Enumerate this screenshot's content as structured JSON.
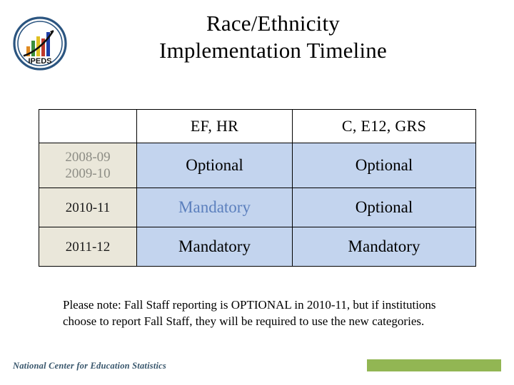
{
  "slide": {
    "title_line1": "Race/Ethnicity",
    "title_line2": "Implementation Timeline",
    "logo_label": "IPEDS",
    "logo_name": "ipeds-logo"
  },
  "table": {
    "columns": [
      "",
      "EF, HR",
      "C, E12, GRS"
    ],
    "rows": [
      {
        "period_line1": "2008-09",
        "period_line2": "2009-10",
        "muted": true,
        "values": [
          "Optional",
          "Optional"
        ],
        "accent": [
          false,
          false
        ]
      },
      {
        "period_line1": "2010-11",
        "period_line2": "",
        "muted": false,
        "values": [
          "Mandatory",
          "Optional"
        ],
        "accent": [
          true,
          false
        ]
      },
      {
        "period_line1": "2011-12",
        "period_line2": "",
        "muted": false,
        "values": [
          "Mandatory",
          "Mandatory"
        ],
        "accent": [
          false,
          false
        ]
      }
    ]
  },
  "note": {
    "text": "Please note:  Fall Staff reporting is OPTIONAL in 2010-11, but if institutions choose to report Fall Staff, they will be required to use the new categories."
  },
  "footer": {
    "organization": "National Center for Education Statistics",
    "bar_color": "#92b653"
  },
  "colors": {
    "header_cell_bg": "#ffffff",
    "period_cell_bg": "#eae7da",
    "value_cell_bg": "#c3d4ee",
    "accent_text": "#5b7fbd",
    "muted_text": "#8d8d85",
    "footer_text": "#37556b",
    "logo_ring": "#2b5580"
  }
}
